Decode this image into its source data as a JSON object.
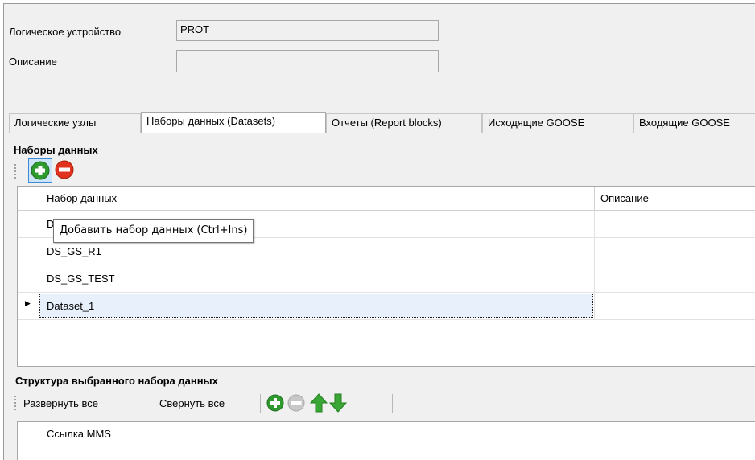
{
  "device": {
    "name_label": "Логическое устройство",
    "name_value": "PROT",
    "desc_label": "Описание",
    "desc_value": ""
  },
  "tabs": [
    {
      "label": "Логические узлы",
      "active": false
    },
    {
      "label": "Наборы данных (Datasets)",
      "active": true
    },
    {
      "label": "Отчеты (Report blocks)",
      "active": false
    },
    {
      "label": "Исходящие GOOSE",
      "active": false
    },
    {
      "label": "Входящие GOOSE",
      "active": false
    }
  ],
  "datasets": {
    "title": "Наборы данных",
    "columns": [
      "Набор данных",
      "Описание"
    ],
    "rows": [
      {
        "name": "D",
        "desc": ""
      },
      {
        "name": "DS_GS_R1",
        "desc": ""
      },
      {
        "name": "DS_GS_TEST",
        "desc": ""
      },
      {
        "name": "Dataset_1",
        "desc": ""
      }
    ],
    "current_row_marker": "▶",
    "tooltip": "Добавить набор данных (Ctrl+Ins)"
  },
  "structure": {
    "title": "Структура выбранного набора данных",
    "expand_all": "Развернуть все",
    "collapse_all": "Свернуть все",
    "column": "Ссылка MMS"
  },
  "colors": {
    "add_green": "#2e9a2e",
    "remove_red": "#e0321e",
    "arrow_green": "#3aa636",
    "disabled_gray": "#c8c8c8",
    "selected_focus": "#1a1a1a"
  }
}
